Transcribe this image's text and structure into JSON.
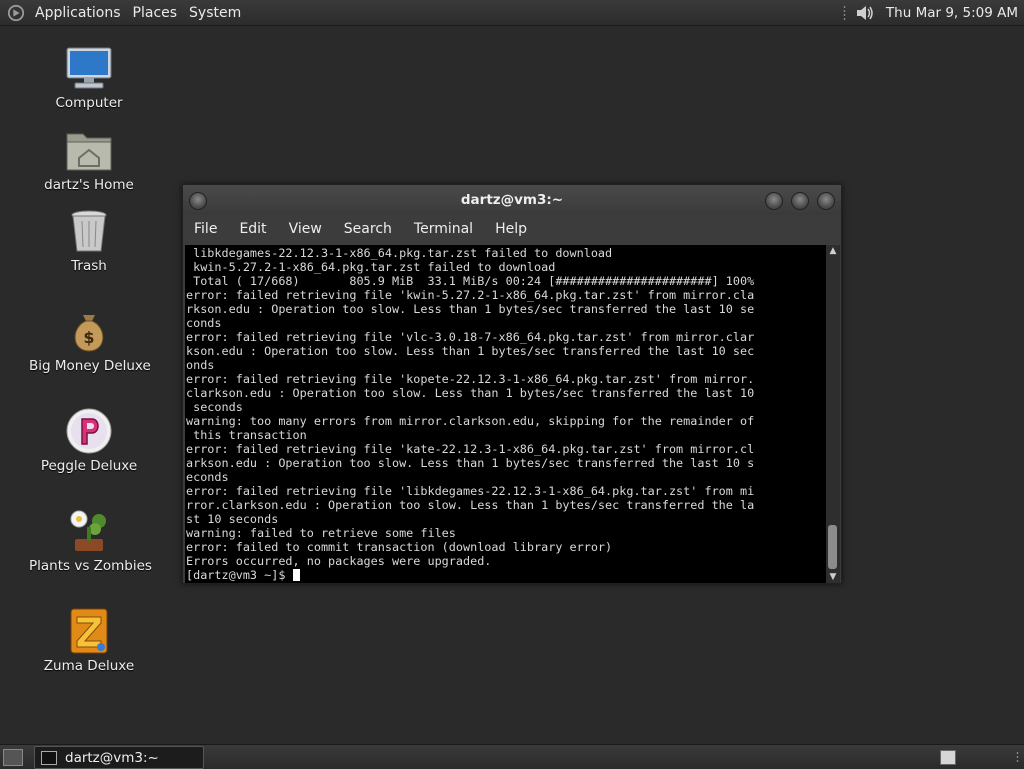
{
  "top_panel": {
    "menus": [
      "Applications",
      "Places",
      "System"
    ],
    "clock": "Thu Mar  9,  5:09 AM"
  },
  "desktop": {
    "icons": [
      {
        "label": "Computer",
        "icon": "computer-icon"
      },
      {
        "label": "dartz's Home",
        "icon": "home-folder-icon"
      },
      {
        "label": "Trash",
        "icon": "trash-icon"
      },
      {
        "label": "Big Money Deluxe",
        "icon": "money-bag-icon"
      },
      {
        "label": "Peggle Deluxe",
        "icon": "peggle-icon"
      },
      {
        "label": "Plants vs Zombies",
        "icon": "plants-vs-zombies-icon"
      },
      {
        "label": "Zuma Deluxe",
        "icon": "zuma-icon"
      }
    ]
  },
  "terminal": {
    "title": "dartz@vm3:~",
    "menu": [
      "File",
      "Edit",
      "View",
      "Search",
      "Terminal",
      "Help"
    ],
    "lines": [
      " libkdegames-22.12.3-1-x86_64.pkg.tar.zst failed to download",
      " kwin-5.27.2-1-x86_64.pkg.tar.zst failed to download",
      " Total ( 17/668)       805.9 MiB  33.1 MiB/s 00:24 [######################] 100%",
      "error: failed retrieving file 'kwin-5.27.2-1-x86_64.pkg.tar.zst' from mirror.cla",
      "rkson.edu : Operation too slow. Less than 1 bytes/sec transferred the last 10 se",
      "conds",
      "error: failed retrieving file 'vlc-3.0.18-7-x86_64.pkg.tar.zst' from mirror.clar",
      "kson.edu : Operation too slow. Less than 1 bytes/sec transferred the last 10 sec",
      "onds",
      "error: failed retrieving file 'kopete-22.12.3-1-x86_64.pkg.tar.zst' from mirror.",
      "clarkson.edu : Operation too slow. Less than 1 bytes/sec transferred the last 10",
      " seconds",
      "warning: too many errors from mirror.clarkson.edu, skipping for the remainder of",
      " this transaction",
      "error: failed retrieving file 'kate-22.12.3-1-x86_64.pkg.tar.zst' from mirror.cl",
      "arkson.edu : Operation too slow. Less than 1 bytes/sec transferred the last 10 s",
      "econds",
      "error: failed retrieving file 'libkdegames-22.12.3-1-x86_64.pkg.tar.zst' from mi",
      "rror.clarkson.edu : Operation too slow. Less than 1 bytes/sec transferred the la",
      "st 10 seconds",
      "warning: failed to retrieve some files",
      "error: failed to commit transaction (download library error)",
      "Errors occurred, no packages were upgraded."
    ],
    "prompt": "[dartz@vm3 ~]$ "
  },
  "bottom_panel": {
    "task_label": "dartz@vm3:~"
  }
}
